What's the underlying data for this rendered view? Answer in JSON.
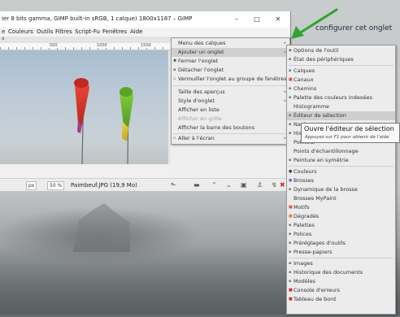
{
  "window": {
    "title": "ier 8 bits gamma, GIMP built-in sRGB, 1 calque) 1800x1187 – GIMP",
    "minimize": "–",
    "maximize": "□",
    "close": "✕"
  },
  "menubar": [
    "e",
    "Couleurs",
    "Outils",
    "Filtres",
    "Script-Fu",
    "Fenêtres",
    "Aide"
  ],
  "tab_strip_label": "x",
  "ruler_labels": [
    "500",
    "1000",
    "1500"
  ],
  "statusbar": {
    "unit": "px",
    "zoom": "50 %",
    "file": "Paimbeuf.JPG (19,9 Mo)"
  },
  "annotation": "configurer cet onglet",
  "colors": {
    "arrow_green": "#2fa52f",
    "close_red": "#d22a2a",
    "windsock_red": "#e23b2e",
    "windsock_green": "#7cc43a"
  },
  "tab_menu": {
    "items": [
      {
        "label": "Menu des calques",
        "arrow": "▸"
      },
      {
        "label": "Ajouter un onglet",
        "arrow": "▸",
        "highlight": true
      },
      {
        "label": "Fermer l'onglet",
        "icon": "✖"
      },
      {
        "label": "Détacher l'onglet",
        "icon": "▪"
      },
      {
        "label": "Verrouiller l'onglet au groupe de fenêtres",
        "icon": "▫"
      },
      {
        "label": "Taille des aperçus",
        "arrow": "▸"
      },
      {
        "label": "Style d'onglet",
        "arrow": "▸"
      },
      {
        "label": "Afficher en liste"
      },
      {
        "label": "Afficher en grille",
        "disabled": true
      },
      {
        "label": "Afficher la barre des boutons"
      },
      {
        "label": "Aller à l'écran",
        "icon": "▫",
        "arrow": "▸"
      }
    ]
  },
  "dock_submenu": {
    "items": [
      {
        "label": "Options de l'outil",
        "icon": "◆"
      },
      {
        "label": "État des périphériques",
        "icon": "▪"
      },
      {
        "label": "Calques",
        "icon": "▪"
      },
      {
        "label": "Canaux",
        "icon": "■"
      },
      {
        "label": "Chemins",
        "icon": "▪"
      },
      {
        "label": "Palette des couleurs indexées",
        "icon": "▪"
      },
      {
        "label": "Histogramme",
        "icon": ""
      },
      {
        "label": "Éditeur de sélection",
        "icon": "▪",
        "highlight": true
      },
      {
        "label": "Navi",
        "icon": "▪"
      },
      {
        "label": "Histo",
        "icon": "▪"
      },
      {
        "label": "Pointeur",
        "icon": ""
      },
      {
        "label": "Points d'échantillonnage",
        "icon": ""
      },
      {
        "label": "Peinture en symétrie",
        "icon": "▪"
      },
      {
        "label": "Couleurs",
        "icon": "●"
      },
      {
        "label": "Brosses",
        "icon": "●"
      },
      {
        "label": "Dynamique de la brosse",
        "icon": "▪"
      },
      {
        "label": "Brosses MyPaint",
        "icon": ""
      },
      {
        "label": "Motifs",
        "icon": "■"
      },
      {
        "label": "Dégradés",
        "icon": "■"
      },
      {
        "label": "Palettes",
        "icon": "▪"
      },
      {
        "label": "Polices",
        "icon": "▪"
      },
      {
        "label": "Préréglages d'outils",
        "icon": "▪"
      },
      {
        "label": "Presse-papiers",
        "icon": "▪"
      },
      {
        "label": "Images",
        "icon": "▪"
      },
      {
        "label": "Historique des documents",
        "icon": "▪"
      },
      {
        "label": "Modèles",
        "icon": "▪"
      },
      {
        "label": "Console d'erreurs",
        "icon": "■"
      },
      {
        "label": "Tableau de bord",
        "icon": "■"
      }
    ]
  },
  "tooltip": {
    "title": "Ouvre l'éditeur de sélection",
    "hint": "Appuyez sur F1 pour obtenir de l'aide"
  }
}
